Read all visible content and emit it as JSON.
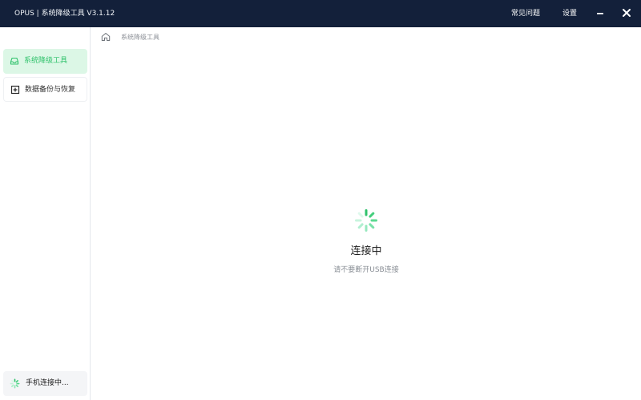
{
  "window": {
    "title": "OPUS | 系统降级工具  V3.1.12",
    "links": {
      "faq": "常见问题",
      "settings": "设置"
    }
  },
  "sidebar": {
    "items": [
      {
        "label": "系统降级工具",
        "active": true,
        "icon": "inbox-icon"
      },
      {
        "label": "数据备份与恢复",
        "active": false,
        "icon": "plus-square-icon"
      }
    ],
    "device_status": "手机连接中..."
  },
  "breadcrumb": {
    "current": "系统降级工具"
  },
  "loading": {
    "title": "连接中",
    "subtitle": "请不要断开USB连接"
  },
  "colors": {
    "titlebar": "#13203a",
    "accent": "#2fc26b",
    "active_nav_bg": "#dcf7e6"
  }
}
